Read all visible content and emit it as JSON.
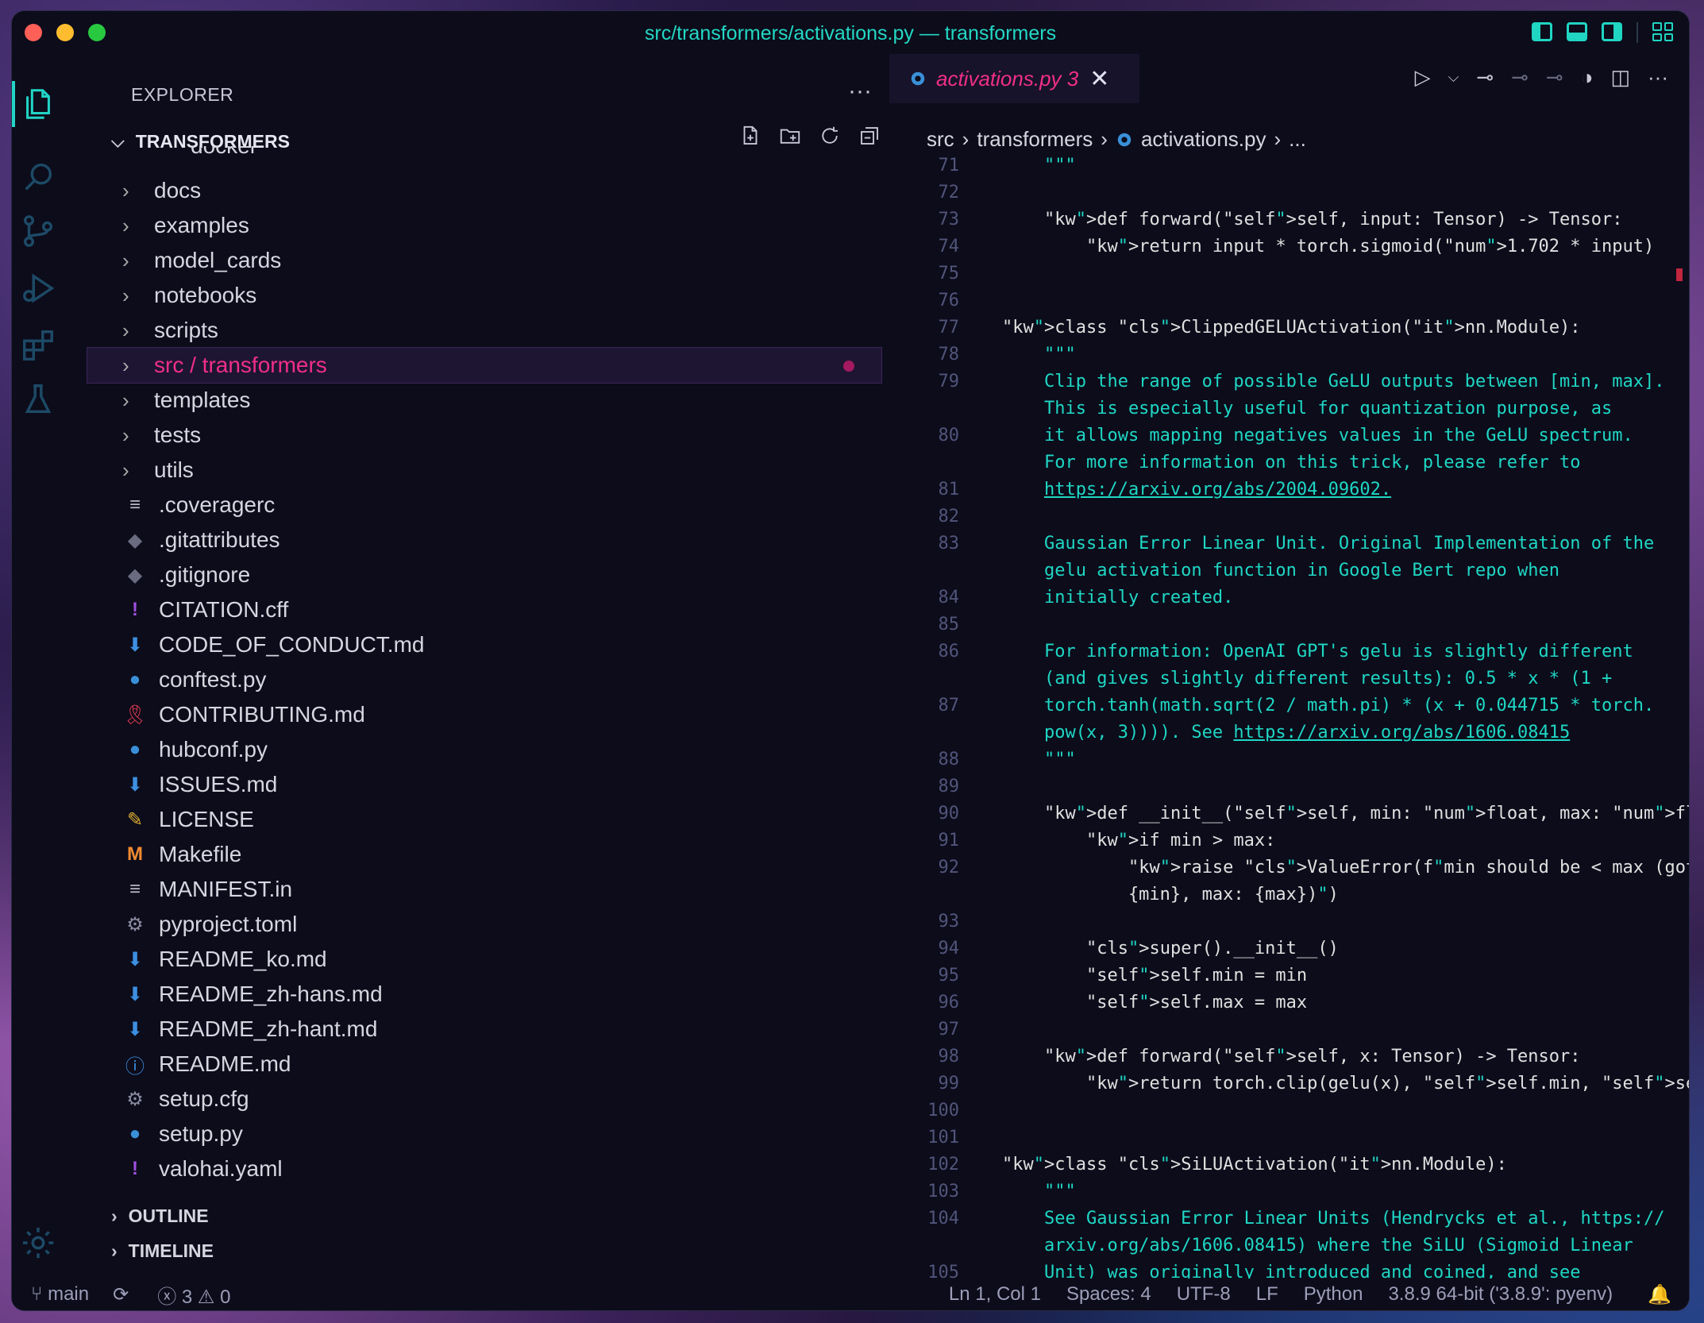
{
  "window": {
    "title": "src/transformers/activations.py — transformers"
  },
  "sidebar": {
    "header": "EXPLORER",
    "project": "TRANSFORMERS",
    "partial_item": "docker",
    "items": [
      {
        "type": "folder",
        "label": "docs"
      },
      {
        "type": "folder",
        "label": "examples"
      },
      {
        "type": "folder",
        "label": "model_cards"
      },
      {
        "type": "folder",
        "label": "notebooks"
      },
      {
        "type": "folder",
        "label": "scripts"
      },
      {
        "type": "folder",
        "label": "src / transformers"
      },
      {
        "type": "folder",
        "label": "templates"
      },
      {
        "type": "folder",
        "label": "tests"
      },
      {
        "type": "folder",
        "label": "utils"
      },
      {
        "type": "file",
        "label": ".coveragerc",
        "icon": "lines-icon"
      },
      {
        "type": "file",
        "label": ".gitattributes",
        "icon": "git-icon"
      },
      {
        "type": "file",
        "label": ".gitignore",
        "icon": "git-icon"
      },
      {
        "type": "file",
        "label": "CITATION.cff",
        "icon": "exclamation-icon"
      },
      {
        "type": "file",
        "label": "CODE_OF_CONDUCT.md",
        "icon": "markdown-icon"
      },
      {
        "type": "file",
        "label": "conftest.py",
        "icon": "python-icon"
      },
      {
        "type": "file",
        "label": "CONTRIBUTING.md",
        "icon": "ribbon-icon"
      },
      {
        "type": "file",
        "label": "hubconf.py",
        "icon": "python-icon"
      },
      {
        "type": "file",
        "label": "ISSUES.md",
        "icon": "markdown-icon"
      },
      {
        "type": "file",
        "label": "LICENSE",
        "icon": "license-icon"
      },
      {
        "type": "file",
        "label": "Makefile",
        "icon": "makefile-icon"
      },
      {
        "type": "file",
        "label": "MANIFEST.in",
        "icon": "lines-icon"
      },
      {
        "type": "file",
        "label": "pyproject.toml",
        "icon": "gear-icon"
      },
      {
        "type": "file",
        "label": "README_ko.md",
        "icon": "markdown-icon"
      },
      {
        "type": "file",
        "label": "README_zh-hans.md",
        "icon": "markdown-icon"
      },
      {
        "type": "file",
        "label": "README_zh-hant.md",
        "icon": "markdown-icon"
      },
      {
        "type": "file",
        "label": "README.md",
        "icon": "info-icon"
      },
      {
        "type": "file",
        "label": "setup.cfg",
        "icon": "gear-icon"
      },
      {
        "type": "file",
        "label": "setup.py",
        "icon": "python-icon"
      },
      {
        "type": "file",
        "label": "valohai.yaml",
        "icon": "exclamation-icon"
      }
    ],
    "sections": [
      "OUTLINE",
      "TIMELINE"
    ]
  },
  "editor": {
    "tab": {
      "name": "activations.py",
      "problems": "3"
    },
    "breadcrumb": [
      "src",
      "transformers",
      "activations.py",
      "..."
    ],
    "code": [
      {
        "n": "71",
        "t": "    \"\"\""
      },
      {
        "n": "72",
        "t": ""
      },
      {
        "n": "73",
        "t": "    def forward(self, input: Tensor) -> Tensor:"
      },
      {
        "n": "74",
        "t": "        return input * torch.sigmoid(1.702 * input)"
      },
      {
        "n": "75",
        "t": ""
      },
      {
        "n": "76",
        "t": ""
      },
      {
        "n": "77",
        "t": "class ClippedGELUActivation(nn.Module):"
      },
      {
        "n": "78",
        "t": "    \"\"\""
      },
      {
        "n": "79",
        "t": "    Clip the range of possible GeLU outputs between [min, max]."
      },
      {
        "n": "",
        "t": "    This is especially useful for quantization purpose, as"
      },
      {
        "n": "80",
        "t": "    it allows mapping negatives values in the GeLU spectrum."
      },
      {
        "n": "",
        "t": "    For more information on this trick, please refer to"
      },
      {
        "n": "81",
        "t": "    https://arxiv.org/abs/2004.09602."
      },
      {
        "n": "82",
        "t": ""
      },
      {
        "n": "83",
        "t": "    Gaussian Error Linear Unit. Original Implementation of the"
      },
      {
        "n": "",
        "t": "    gelu activation function in Google Bert repo when"
      },
      {
        "n": "84",
        "t": "    initially created."
      },
      {
        "n": "85",
        "t": ""
      },
      {
        "n": "86",
        "t": "    For information: OpenAI GPT's gelu is slightly different"
      },
      {
        "n": "",
        "t": "    (and gives slightly different results): 0.5 * x * (1 +"
      },
      {
        "n": "87",
        "t": "    torch.tanh(math.sqrt(2 / math.pi) * (x + 0.044715 * torch."
      },
      {
        "n": "",
        "t": "    pow(x, 3)))). See https://arxiv.org/abs/1606.08415"
      },
      {
        "n": "88",
        "t": "    \"\"\""
      },
      {
        "n": "89",
        "t": ""
      },
      {
        "n": "90",
        "t": "    def __init__(self, min: float, max: float):"
      },
      {
        "n": "91",
        "t": "        if min > max:"
      },
      {
        "n": "92",
        "t": "            raise ValueError(f\"min should be < max (got min:"
      },
      {
        "n": "",
        "t": "            {min}, max: {max})\")"
      },
      {
        "n": "93",
        "t": ""
      },
      {
        "n": "94",
        "t": "        super().__init__()"
      },
      {
        "n": "95",
        "t": "        self.min = min"
      },
      {
        "n": "96",
        "t": "        self.max = max"
      },
      {
        "n": "97",
        "t": ""
      },
      {
        "n": "98",
        "t": "    def forward(self, x: Tensor) -> Tensor:"
      },
      {
        "n": "99",
        "t": "        return torch.clip(gelu(x), self.min, self.max)"
      },
      {
        "n": "100",
        "t": ""
      },
      {
        "n": "101",
        "t": ""
      },
      {
        "n": "102",
        "t": "class SiLUActivation(nn.Module):"
      },
      {
        "n": "103",
        "t": "    \"\"\""
      },
      {
        "n": "104",
        "t": "    See Gaussian Error Linear Units (Hendrycks et al., https://"
      },
      {
        "n": "",
        "t": "    arxiv.org/abs/1606.08415) where the SiLU (Sigmoid Linear"
      },
      {
        "n": "105",
        "t": "    Unit) was originally introduced and coined, and see"
      }
    ]
  },
  "status": {
    "branch": "main",
    "errors": "3",
    "warnings": "0",
    "position": "Ln 1, Col 1",
    "spaces": "Spaces: 4",
    "encoding": "UTF-8",
    "eol": "LF",
    "language": "Python",
    "interpreter": "3.8.9 64-bit ('3.8.9': pyenv)"
  },
  "colors": {
    "accent": "#22d3c5",
    "selection": "#f02e8a",
    "background": "#0c0c1b"
  }
}
